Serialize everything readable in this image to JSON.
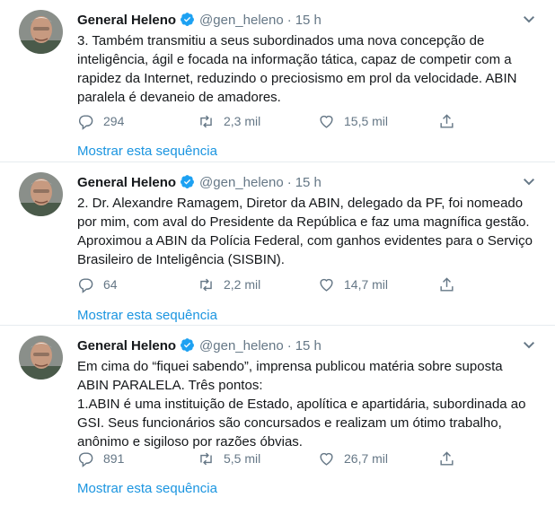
{
  "colors": {
    "link": "#1b95e0",
    "muted": "#657786",
    "verified": "#1da1f2",
    "text": "#14171a"
  },
  "tweets": [
    {
      "name": "General Heleno",
      "handle": "@gen_heleno",
      "dot": "·",
      "time": "15 h",
      "text_lines": [
        "3. Também transmitiu a seus subordinados uma nova concepção de",
        "inteligência, ágil e focada na informação tática, capaz de competir com a",
        "rapidez da Internet, reduzindo o preciosismo em prol da velocidade. ABIN",
        "paralela é devaneio de amadores."
      ],
      "replies": "294",
      "retweets": "2,3 mil",
      "likes": "15,5 mil",
      "thread_link": "Mostrar esta sequência"
    },
    {
      "name": "General Heleno",
      "handle": "@gen_heleno",
      "dot": "·",
      "time": "15 h",
      "text_lines": [
        "2. Dr. Alexandre Ramagem, Diretor da ABIN, delegado da PF, foi nomeado",
        "por mim, com aval do Presidente da República e faz uma magnífica gestão.",
        "Aproximou a ABIN da Polícia Federal, com ganhos evidentes para o Serviço",
        "Brasileiro de Inteligência (SISBIN)."
      ],
      "replies": "64",
      "retweets": "2,2 mil",
      "likes": "14,7 mil",
      "thread_link": "Mostrar esta sequência"
    },
    {
      "name": "General Heleno",
      "handle": "@gen_heleno",
      "dot": "·",
      "time": "15 h",
      "text_lines": [
        "Em cima do “fiquei sabendo”, imprensa publicou matéria sobre suposta",
        "ABIN PARALELA. Três pontos:",
        "1.ABIN é uma instituição de Estado, apolítica e apartidária, subordinada ao",
        "GSI. Seus funcionários são concursados e realizam um ótimo trabalho,",
        "anônimo e sigiloso por razões óbvias."
      ],
      "replies": "891",
      "retweets": "5,5 mil",
      "likes": "26,7 mil",
      "thread_link": "Mostrar esta sequência"
    }
  ],
  "icons": {
    "avatar": "avatar-photo",
    "verified": "verified-badge-icon",
    "caret": "chevron-down-icon",
    "reply": "reply-icon",
    "retweet": "retweet-icon",
    "like": "heart-icon",
    "share": "share-icon"
  }
}
